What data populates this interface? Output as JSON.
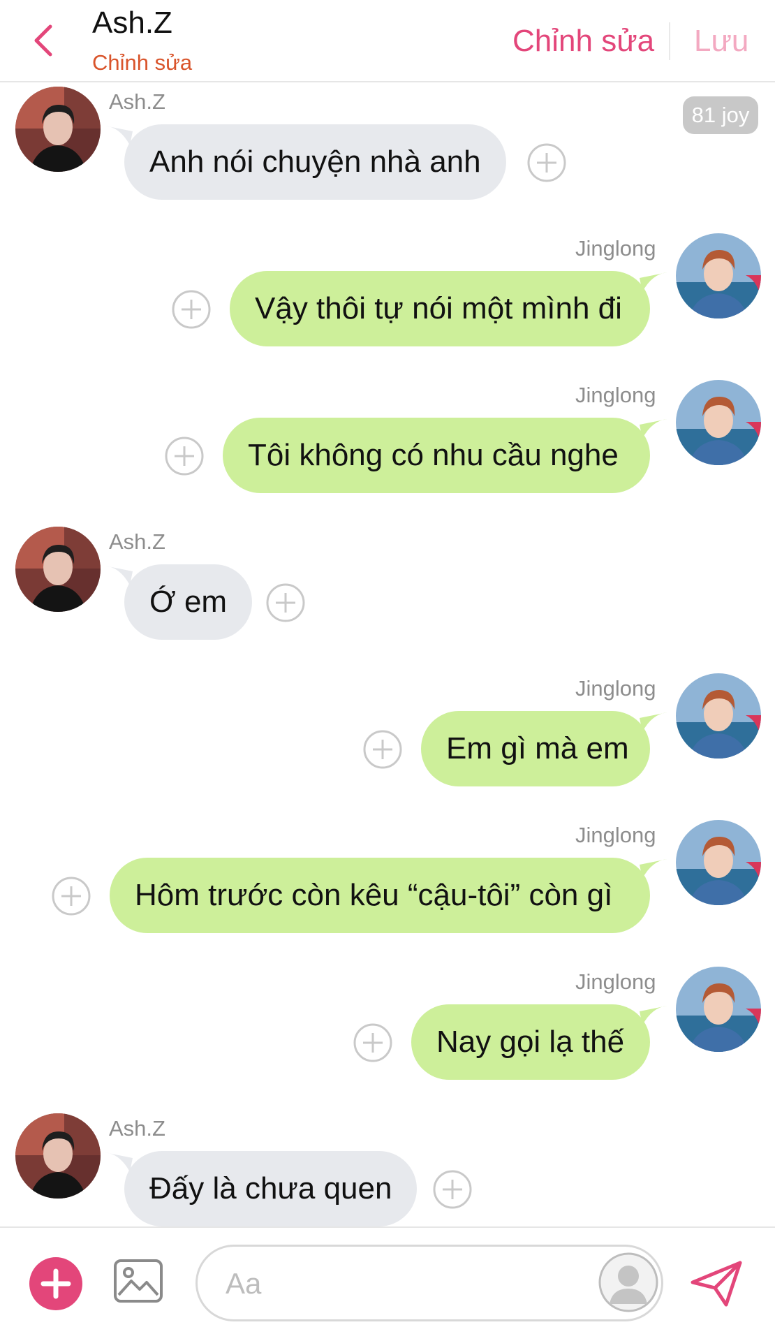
{
  "header": {
    "name": "Ash.Z",
    "subtitle": "Chỉnh sửa",
    "edit_label": "Chỉnh sửa",
    "save_label": "Lưu"
  },
  "joy_badge": "81 joy",
  "messages": [
    {
      "side": "left",
      "sender": "Ash.Z",
      "text": "Anh nói chuyện nhà anh"
    },
    {
      "side": "right",
      "sender": "Jinglong",
      "text": "Vậy thôi tự nói một mình đi"
    },
    {
      "side": "right",
      "sender": "Jinglong",
      "text": "Tôi không có nhu cầu nghe"
    },
    {
      "side": "left",
      "sender": "Ash.Z",
      "text": "Ớ em"
    },
    {
      "side": "right",
      "sender": "Jinglong",
      "text": "Em gì mà em"
    },
    {
      "side": "right",
      "sender": "Jinglong",
      "text": "Hôm trước còn kêu “cậu-tôi” còn gì"
    },
    {
      "side": "right",
      "sender": "Jinglong",
      "text": "Nay gọi lạ thế"
    },
    {
      "side": "left",
      "sender": "Ash.Z",
      "text": "Đấy là chưa quen"
    }
  ],
  "composer": {
    "placeholder": "Aa"
  },
  "colors": {
    "accent": "#e3467a",
    "accent_light": "#f3a9c1",
    "subtitle": "#d9542b",
    "incoming_bubble": "#e7e9ed",
    "outgoing_bubble": "#cdef9a"
  }
}
